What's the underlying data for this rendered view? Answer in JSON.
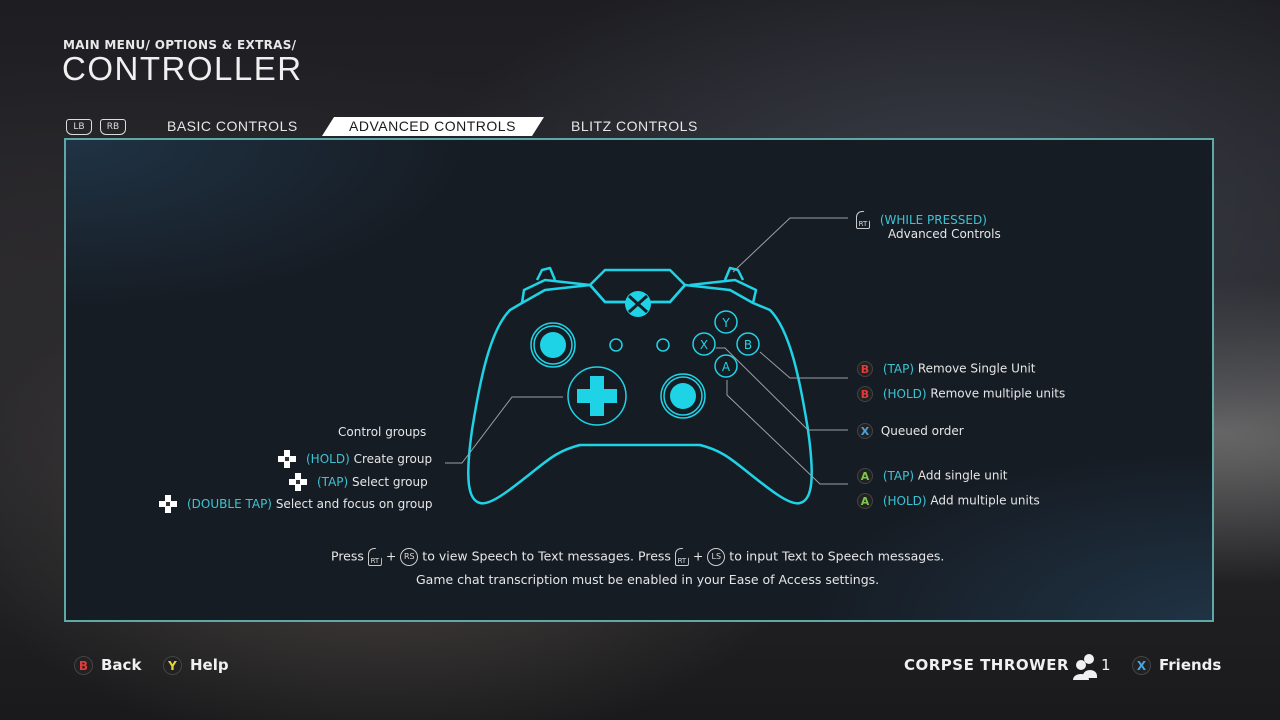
{
  "header": {
    "breadcrumb": "MAIN MENU/ OPTIONS & EXTRAS/",
    "title": "CONTROLLER"
  },
  "tabs": {
    "bumper_left": "LB",
    "bumper_right": "RB",
    "items": [
      {
        "label": "BASIC CONTROLS",
        "active": false
      },
      {
        "label": "ADVANCED CONTROLS",
        "active": true
      },
      {
        "label": "BLITZ CONTROLS",
        "active": false
      }
    ]
  },
  "colors": {
    "accent_cyan": "#1fd3e6",
    "highlight_text": "#3cc4d4",
    "panel_border": "#5fa8a8",
    "button_b": "#e23a3a",
    "button_a": "#7dc84b",
    "button_x": "#4aa3df",
    "button_y": "#e7d33a"
  },
  "controller": {
    "face_buttons": {
      "y": "Y",
      "x": "X",
      "b": "B",
      "a": "A"
    }
  },
  "callouts": {
    "rt": {
      "icon": "RT",
      "tag": "(WHILE PRESSED)",
      "text": "Advanced Controls"
    },
    "b_tap": {
      "icon": "B",
      "tag": "(TAP)",
      "text": " Remove Single Unit"
    },
    "b_hold": {
      "icon": "B",
      "tag": "(HOLD)",
      "text": " Remove multiple units"
    },
    "x": {
      "icon": "X",
      "text": "Queued order"
    },
    "a_tap": {
      "icon": "A",
      "tag": "(TAP)",
      "text": " Add single unit"
    },
    "a_hold": {
      "icon": "A",
      "tag": "(HOLD)",
      "text": " Add multiple units"
    },
    "dpad_title": "Control groups",
    "dpad_hold": {
      "tag": "(HOLD)",
      "text": " Create group"
    },
    "dpad_tap": {
      "tag": "(TAP)",
      "text": " Select group"
    },
    "dpad_double": {
      "tag": "(DOUBLE TAP)",
      "text": " Select and focus on group"
    }
  },
  "note": {
    "press1": "Press",
    "rt1": "RT",
    "rs": "RS",
    "mid": "to view Speech to Text messages. Press",
    "rt2": "RT",
    "ls": "LS",
    "end": "to input Text to Speech messages.",
    "line2": "Game chat transcription must be enabled in your Ease of Access settings."
  },
  "footer": {
    "back": {
      "icon": "B",
      "label": "Back"
    },
    "help": {
      "icon": "Y",
      "label": "Help"
    },
    "gamertag": "CORPSE THROWER",
    "party_count": "1",
    "friends": {
      "icon": "X",
      "label": "Friends"
    }
  }
}
